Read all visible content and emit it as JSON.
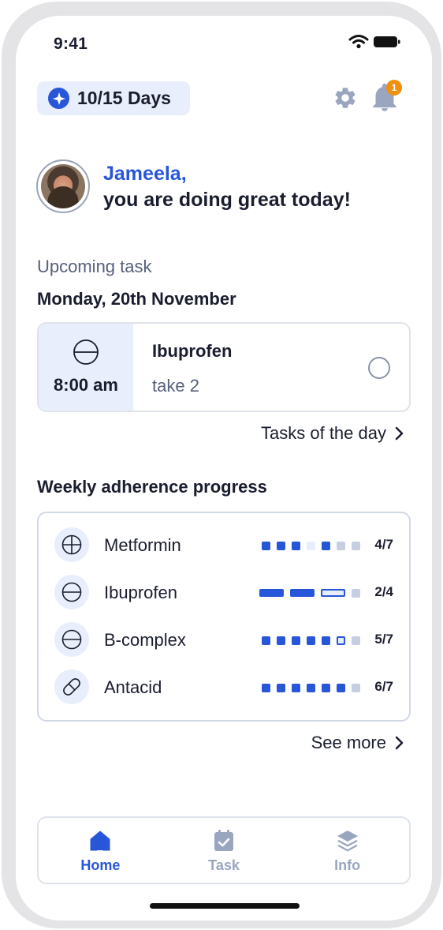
{
  "status_bar": {
    "time": "9:41"
  },
  "header": {
    "streak_label": "10/15 Days",
    "notification_count": "1"
  },
  "greeting": {
    "name": "Jameela,",
    "message": "you are doing great today!"
  },
  "upcoming": {
    "label": "Upcoming task",
    "date": "Monday, 20th November",
    "task": {
      "time": "8:00 am",
      "name": "Ibuprofen",
      "dose": "take 2"
    },
    "link": "Tasks of the day"
  },
  "weekly": {
    "title": "Weekly adherence progress",
    "meds": [
      {
        "name": "Metformin",
        "icon": "pill-cross-icon",
        "count": "4/7",
        "total": 7,
        "states": [
          "done",
          "done",
          "done",
          "missed",
          "done",
          "pending",
          "pending"
        ]
      },
      {
        "name": "Ibuprofen",
        "icon": "pill-half-icon",
        "count": "2/4",
        "total": 4,
        "states": [
          "done",
          "done",
          "current",
          "pending"
        ]
      },
      {
        "name": "B-complex",
        "icon": "pill-half-icon",
        "count": "5/7",
        "total": 7,
        "states": [
          "done",
          "done",
          "done",
          "done",
          "done",
          "current",
          "pending"
        ]
      },
      {
        "name": "Antacid",
        "icon": "capsule-icon",
        "count": "6/7",
        "total": 7,
        "states": [
          "done",
          "done",
          "done",
          "done",
          "done",
          "done",
          "pending"
        ]
      }
    ],
    "link": "See more"
  },
  "tabs": [
    {
      "label": "Home",
      "icon": "home-icon",
      "active": true
    },
    {
      "label": "Task",
      "icon": "calendar-check-icon",
      "active": false
    },
    {
      "label": "Info",
      "icon": "layers-icon",
      "active": false
    }
  ],
  "colors": {
    "accent": "#2756d8",
    "accent_light": "#e8eefb",
    "badge": "#f0900e",
    "dot_done": "#2756d8",
    "dot_missed": "#e8eefb",
    "dot_pending": "#c6cfe2",
    "inactive": "#9aa6c0"
  }
}
